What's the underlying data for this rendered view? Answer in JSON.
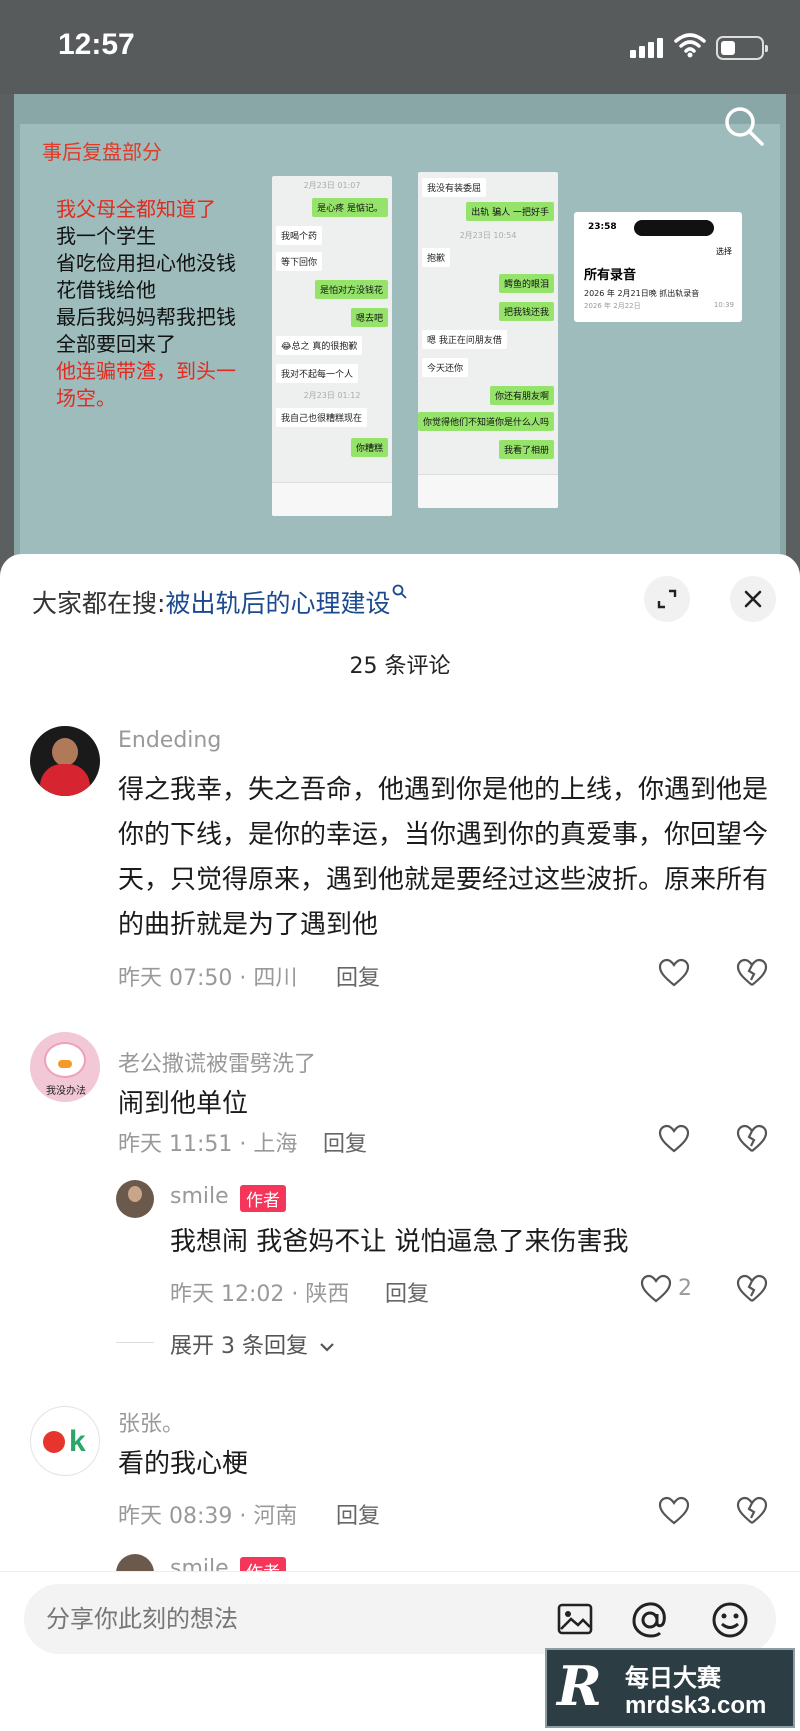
{
  "status_bar": {
    "time": "12:57"
  },
  "video": {
    "slide_title": "事后复盘部分",
    "story_lines": [
      {
        "text": "我父母全都知道了",
        "red": true
      },
      {
        "text": "我一个学生",
        "red": false
      },
      {
        "text": "省吃俭用担心他没钱",
        "red": false
      },
      {
        "text": "花借钱给他",
        "red": false
      },
      {
        "text": "最后我妈妈帮我把钱",
        "red": false
      },
      {
        "text": "全部要回来了",
        "red": false
      },
      {
        "text": "他连骗带渣，到头一",
        "red": true
      },
      {
        "text": "场空。",
        "red": true
      }
    ],
    "chat1": {
      "ts1": "2月23日 01:07",
      "m1": "是心疼 是惦记。",
      "m2": "我喝个药",
      "m3": "等下回你",
      "m4": "是怕对方没钱花",
      "m5": "嗯去吧",
      "m6": "😂总之 真的很抱歉",
      "m7": "我对不起每一个人",
      "ts2": "2月23日 01:12",
      "m8": "我自己也很糟糕现在",
      "m9": "你糟糕"
    },
    "chat2": {
      "m1": "我没有装委屈",
      "m2": "出轨 骗人 一把好手",
      "ts1": "2月23日 10:54",
      "m3": "抱歉",
      "m4": "鳄鱼的眼泪",
      "m5": "把我钱还我",
      "m6": "嗯 我正在问朋友借",
      "m7": "今天还你",
      "m8": "你还有朋友啊",
      "m9": "你觉得他们不知道你是什么人吗",
      "m10": "我看了相册"
    },
    "recordings": {
      "clock": "23:58",
      "select": "选择",
      "heading": "所有录音",
      "item_title": "2026 年 2月21日晚 抓出轨录音",
      "item_date": "2026 年 2月22日",
      "item_duration": "10:39"
    }
  },
  "sheet": {
    "hot_search_prefix": "大家都在搜:",
    "hot_search_term": "被出轨后的心理建设",
    "comment_count": "25 条评论",
    "comments": [
      {
        "name": "Endeding",
        "text": "得之我幸，失之吾命，他遇到你是他的上线，你遇到他是你的下线，是你的幸运，当你遇到你的真爱事，你回望今天，只觉得原来，遇到他就是要经过这些波折。原来所有的曲折就是为了遇到他",
        "meta": "昨天 07:50 · 四川",
        "reply": "回复"
      },
      {
        "name": "老公撒谎被雷劈洗了",
        "avatar_text": "我没办法",
        "text": "闹到他单位",
        "meta": "昨天 11:51 · 上海",
        "reply": "回复"
      },
      {
        "name": "smile",
        "tag": "作者",
        "text": "我想闹 我爸妈不让 说怕逼急了来伤害我",
        "meta": "昨天 12:02 · 陕西",
        "reply": "回复",
        "likes": "2"
      },
      {
        "name": "张张。",
        "text": "看的我心梗",
        "meta": "昨天 08:39 · 河南",
        "reply": "回复"
      },
      {
        "name": "smile",
        "tag": "作者"
      }
    ],
    "expand_replies": "展开 3 条回复"
  },
  "input": {
    "placeholder": "分享你此刻的想法"
  },
  "watermark": {
    "line1": "每日大赛",
    "line2": "mrdsk3.com",
    "logo": "R"
  },
  "colors": {
    "link_blue": "#1c4a8f",
    "author_tag": "#f5355a",
    "chat_green": "#95e36a"
  }
}
